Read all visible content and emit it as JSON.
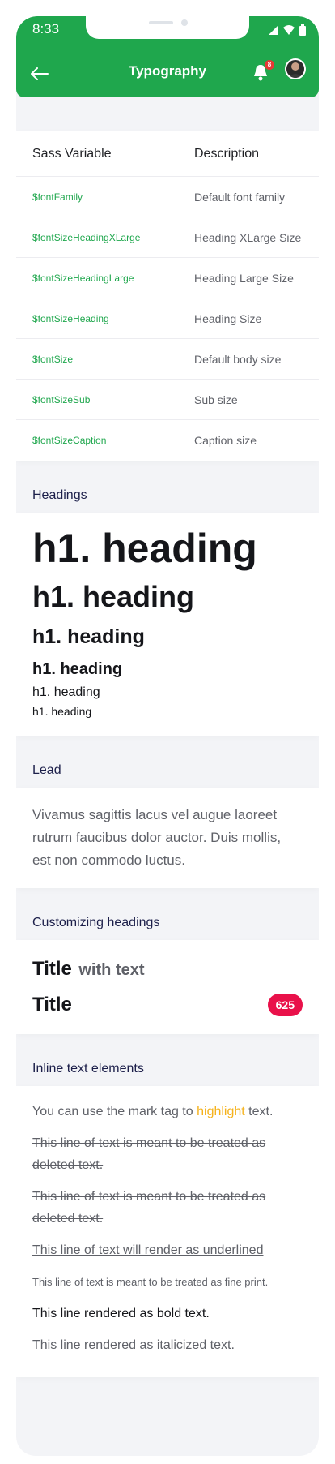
{
  "status": {
    "time": "8:33"
  },
  "appbar": {
    "title": "Typography",
    "notification_count": "8"
  },
  "variables": {
    "headers": [
      "Sass Variable",
      "Description"
    ],
    "rows": [
      {
        "name": "$fontFamily",
        "desc": "Default font family"
      },
      {
        "name": "$fontSizeHeadingXLarge",
        "desc": "Heading XLarge Size"
      },
      {
        "name": "$fontSizeHeadingLarge",
        "desc": "Heading Large Size"
      },
      {
        "name": "$fontSizeHeading",
        "desc": "Heading Size"
      },
      {
        "name": "$fontSize",
        "desc": "Default body size"
      },
      {
        "name": "$fontSizeSub",
        "desc": "Sub size"
      },
      {
        "name": "$fontSizeCaption",
        "desc": "Caption size"
      }
    ]
  },
  "headings": {
    "label": "Headings",
    "items": [
      "h1. heading",
      "h1. heading",
      "h1. heading",
      "h1. heading",
      "h1. heading",
      "h1. heading"
    ]
  },
  "lead": {
    "label": "Lead",
    "text": "Vivamus sagittis lacus vel augue laoreet rutrum faucibus dolor auctor. Duis mollis, est non commodo luctus."
  },
  "custom": {
    "label": "Customizing headings",
    "title1": "Title",
    "title1_sub": "with text",
    "title2": "Title",
    "badge": "625"
  },
  "inline": {
    "label": "Inline text elements",
    "mark_before": "You can use the mark tag to",
    "mark_word": "highlight",
    "mark_after": "text.",
    "deleted1": "This line of text is meant to be treated as deleted text.",
    "deleted2": "This line of text is meant to be treated as deleted text.",
    "underlined": "This line of text will render as underlined",
    "fine": "This line of text is meant to be treated as fine print.",
    "bold": "This line rendered as bold text.",
    "italic": "This line rendered as italicized text."
  },
  "colors": {
    "primary": "#1fa74d",
    "badge": "#e9114a",
    "mark": "#f5b21c"
  }
}
